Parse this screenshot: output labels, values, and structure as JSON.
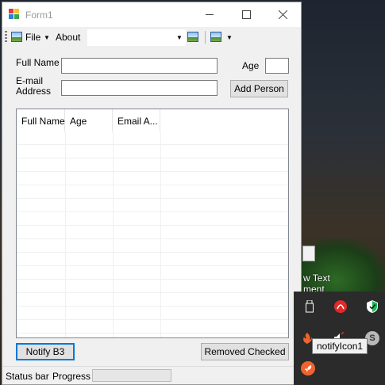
{
  "desktop": {
    "icon_label_line1": "w Text",
    "icon_label_line2": "ment"
  },
  "window": {
    "title": "Form1",
    "menu": {
      "file_label": "File",
      "about_label": "About",
      "combo_value": ""
    },
    "form": {
      "fullname_label": "Full Name",
      "fullname_value": "",
      "age_label": "Age",
      "age_value": "",
      "email_label_line1": "E-mail",
      "email_label_line2": "Address",
      "email_value": "",
      "add_button": "Add Person"
    },
    "list": {
      "columns": [
        "Full Name",
        "Age",
        "Email A..."
      ],
      "rows": []
    },
    "notify_button": "Notify B3",
    "remove_button": "Removed Checked",
    "status": {
      "label": "Status bar",
      "progress_label": "Progress",
      "progress_value": 0
    }
  },
  "tray": {
    "icons": [
      "usb-icon",
      "app-red-icon",
      "shield-icon",
      "fire-icon",
      "audio-icon",
      "skype-icon",
      "rocket-icon"
    ],
    "tooltip": "notifyIcon1",
    "colors": {
      "red": "#e02a2a",
      "green": "#1db954",
      "orange": "#f0632e"
    }
  }
}
